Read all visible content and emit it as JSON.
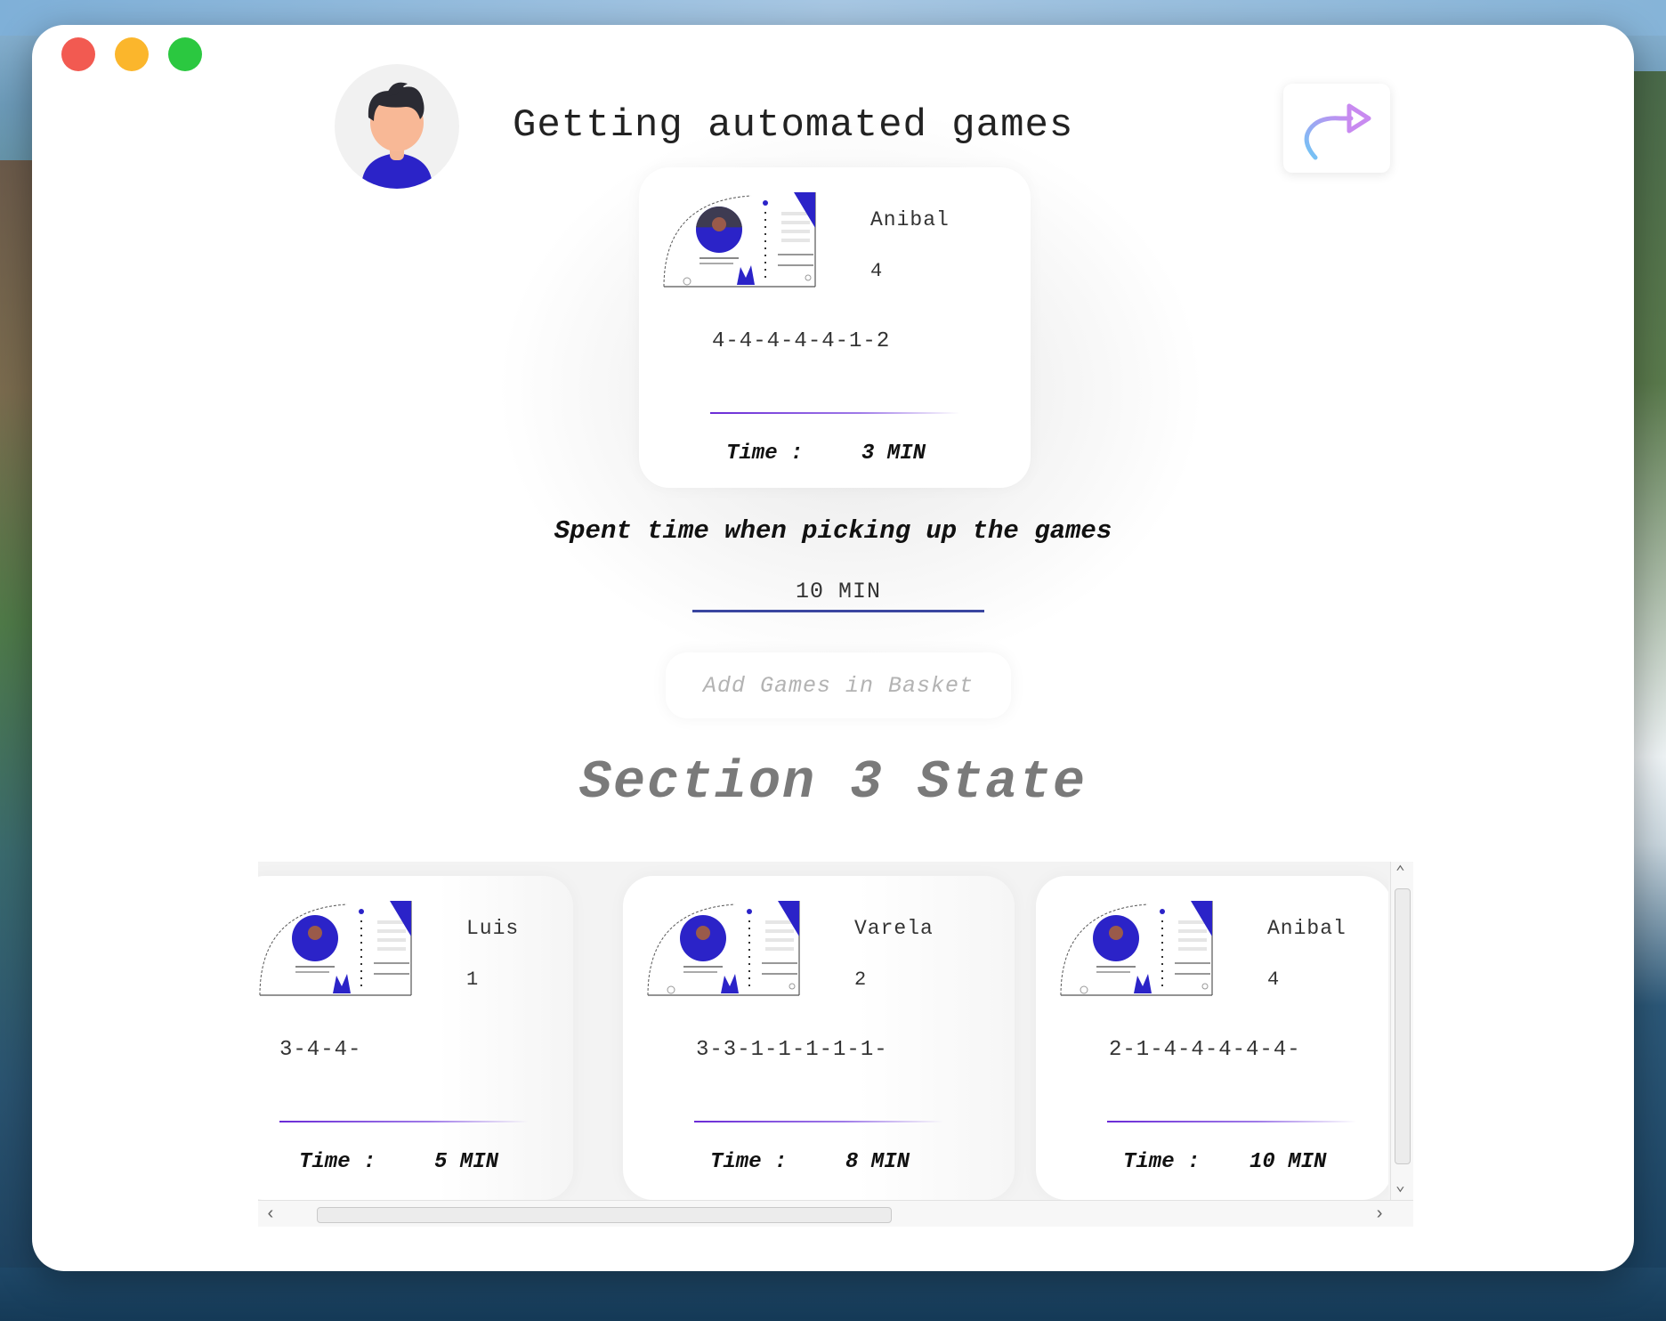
{
  "window": {
    "title": "Getting automated games"
  },
  "featured_card": {
    "name": "Anibal",
    "number": "4",
    "sequence": "4-4-4-4-4-1-2",
    "time_label": "Time :",
    "time_value": "3 MIN"
  },
  "spent": {
    "label": "Spent time when picking up the games",
    "value": "10 MIN"
  },
  "add_button": {
    "label": "Add Games in Basket"
  },
  "section": {
    "title": "Section 3 State",
    "cards": [
      {
        "name": "Luis",
        "number": "1",
        "sequence": "3-4-4-",
        "time_label": "Time :",
        "time_value": "5 MIN"
      },
      {
        "name": "Varela",
        "number": "2",
        "sequence": "3-3-1-1-1-1-1-",
        "time_label": "Time :",
        "time_value": "8 MIN"
      },
      {
        "name": "Anibal",
        "number": "4",
        "sequence": "2-1-4-4-4-4-4-",
        "time_label": "Time :",
        "time_value": "10 MIN"
      }
    ]
  },
  "icons": {
    "avatar": "user-avatar",
    "share": "share-arrow-icon",
    "card_illustration": "profile-card-illustration"
  },
  "colors": {
    "accent": "#3a46a0",
    "purple": "#6a2ad6",
    "traffic_red": "#f25a51",
    "traffic_yellow": "#fbb62c",
    "traffic_green": "#2bc840"
  }
}
